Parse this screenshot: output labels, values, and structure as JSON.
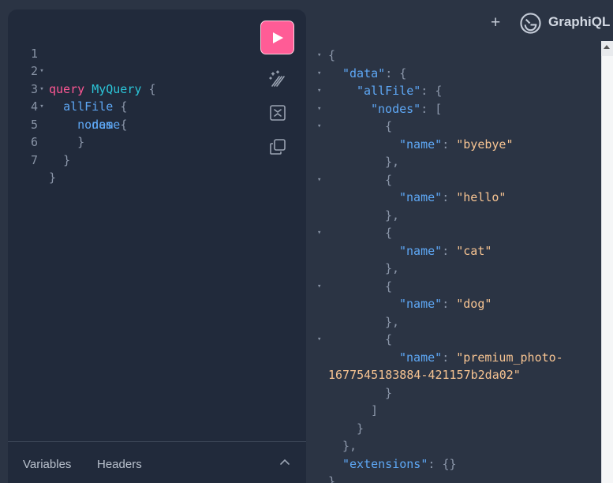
{
  "editor": {
    "lines": [
      {
        "num": "1",
        "fold": "▾"
      },
      {
        "num": "2",
        "fold": "▾"
      },
      {
        "num": "3",
        "fold": "▾"
      },
      {
        "num": "4",
        "fold": ""
      },
      {
        "num": "5",
        "fold": ""
      },
      {
        "num": "6",
        "fold": ""
      },
      {
        "num": "7",
        "fold": ""
      }
    ],
    "tokens": {
      "query_kw": "query",
      "op_name": "MyQuery",
      "open_brace": "{",
      "allfile": "allFile",
      "nodes": "nodes",
      "name": "name",
      "close_brace": "}"
    },
    "footer": {
      "variables_tab": "Variables",
      "headers_tab": "Headers"
    }
  },
  "toolbar": {
    "run_icon": "play-icon",
    "prettify_icon": "magic-wand-icon",
    "merge_icon": "merge-fragments-icon",
    "copy_icon": "copy-icon"
  },
  "header": {
    "add_tab": "+",
    "brand": "GraphiQL"
  },
  "result": {
    "k_data": "\"data\"",
    "k_allfile": "\"allFile\"",
    "k_nodes": "\"nodes\"",
    "k_name": "\"name\"",
    "k_extensions": "\"extensions\"",
    "values": [
      "\"byebye\"",
      "\"hello\"",
      "\"cat\"",
      "\"dog\""
    ],
    "long_value_1": "\"premium_photo-",
    "long_value_2": "1677545183884-421157b2da02\"",
    "empty_obj": "{}"
  },
  "colors": {
    "accent": "#ff5c96",
    "background": "#2b3444",
    "editor_bg": "#212a3b"
  }
}
